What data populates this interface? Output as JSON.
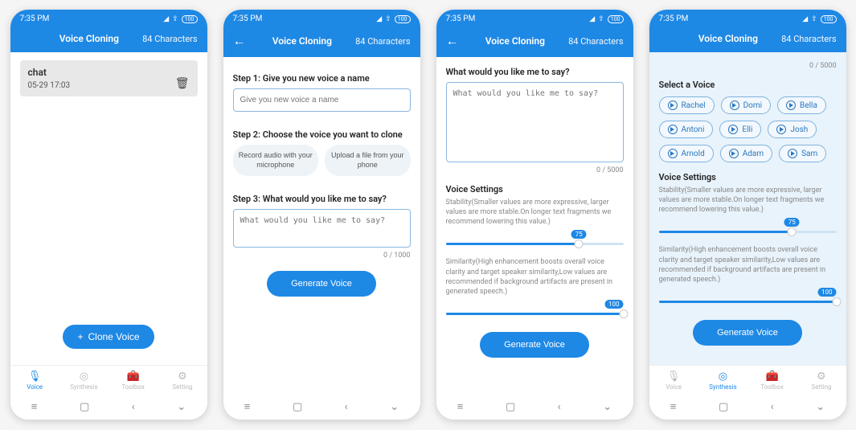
{
  "colors": {
    "primary": "#1e88e5"
  },
  "status": {
    "time": "7:35 PM",
    "battery": "100"
  },
  "header": {
    "title": "Voice Cloning",
    "chars": "84 Characters"
  },
  "screen1": {
    "item_name": "chat",
    "item_date": "05-29 17:03",
    "clone_btn": "Clone Voice"
  },
  "screen2": {
    "step1": "Step 1: Give you new voice a name",
    "step1_placeholder": "Give you new voice a name",
    "step2": "Step 2: Choose the voice you want to clone",
    "opt1": "Record audio with your microphone",
    "opt2": "Upload a file from your phone",
    "step3": "Step 3: What would you like me to say?",
    "step3_placeholder": "What would you like me to say?",
    "counter": "0 / 1000",
    "gen": "Generate Voice"
  },
  "screen3": {
    "prompt_label": "What would you like me to say?",
    "prompt_placeholder": "What would you like me to say?",
    "counter": "0 / 5000",
    "settings_title": "Voice Settings",
    "stability_desc": "Stability(Smaller values are more expressive, larger values are more stable.On longer text fragments we recommend lowering this value.)",
    "similarity_desc": "Similarity(High enhancement boosts overall voice clarity and target speaker similarity,Low values are recommended if background artifacts are present in generated speech.)",
    "stability_val": "75",
    "similarity_val": "100",
    "gen": "Generate Voice"
  },
  "screen4": {
    "counter": "0 / 5000",
    "select_label": "Select a Voice",
    "voices": [
      "Rachel",
      "Domi",
      "Bella",
      "Antoni",
      "Elli",
      "Josh",
      "Arnold",
      "Adam",
      "Sam"
    ],
    "settings_title": "Voice Settings",
    "stability_desc": "Stability(Smaller values are more expressive, larger values are more stable.On longer text fragments we recommend lowering this value.)",
    "similarity_desc": "Similarity(High enhancement boosts overall voice clarity and target speaker similarity,Low values are recommended if background artifacts are present in generated speech.)",
    "stability_val": "75",
    "similarity_val": "100",
    "gen": "Generate Voice"
  },
  "nav": {
    "items": [
      {
        "label": "Voice"
      },
      {
        "label": "Synthesis"
      },
      {
        "label": "Toolbox"
      },
      {
        "label": "Setting"
      }
    ]
  }
}
